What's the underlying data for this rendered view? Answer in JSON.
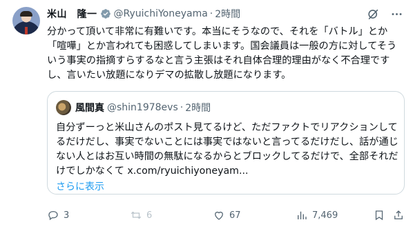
{
  "tweet": {
    "author_name": "米山　隆一",
    "handle": "@RyuichiYoneyama",
    "separator": "·",
    "time": "2時間",
    "text": "分かって頂いて非常に有難いです。本当にそうなので、それを「バトル」とか「喧嘩」とか言われても困惑してしまいます。国会議員は一般の方に対してそういう事実の指摘すらするなと言う主張はそれ自体合理的理由がなく不合理ですし、言いたい放題になりデマの拡散し放題になります。"
  },
  "quote": {
    "author_name": "風間真",
    "handle": "@shin1978evs",
    "separator": "·",
    "time": "2時間",
    "text": "自分ずーっと米山さんのポスト見てるけど、ただファクトでリアクションしてるだけだし、事実でないことには事実ではないと言ってるだけだし、話が通じない人とはお互い時間の無駄になるからとブロックしてるだけで、全部それだけでしかなくて x.com/ryuichiyoneyam...",
    "show_more": "さらに表示"
  },
  "actions": {
    "replies": "3",
    "reposts": "6",
    "likes": "67",
    "views": "7,469"
  },
  "icons": {
    "verified": "verified-badge-icon",
    "grok": "grok-icon",
    "more": "more-icon",
    "reply": "reply-icon",
    "repost": "repost-icon",
    "like": "like-icon",
    "views": "views-icon",
    "bookmark": "bookmark-icon",
    "share": "share-icon"
  },
  "colors": {
    "accent": "#1d9bf0",
    "text": "#0f1419",
    "secondary": "#536471",
    "border": "#cfd9de"
  }
}
